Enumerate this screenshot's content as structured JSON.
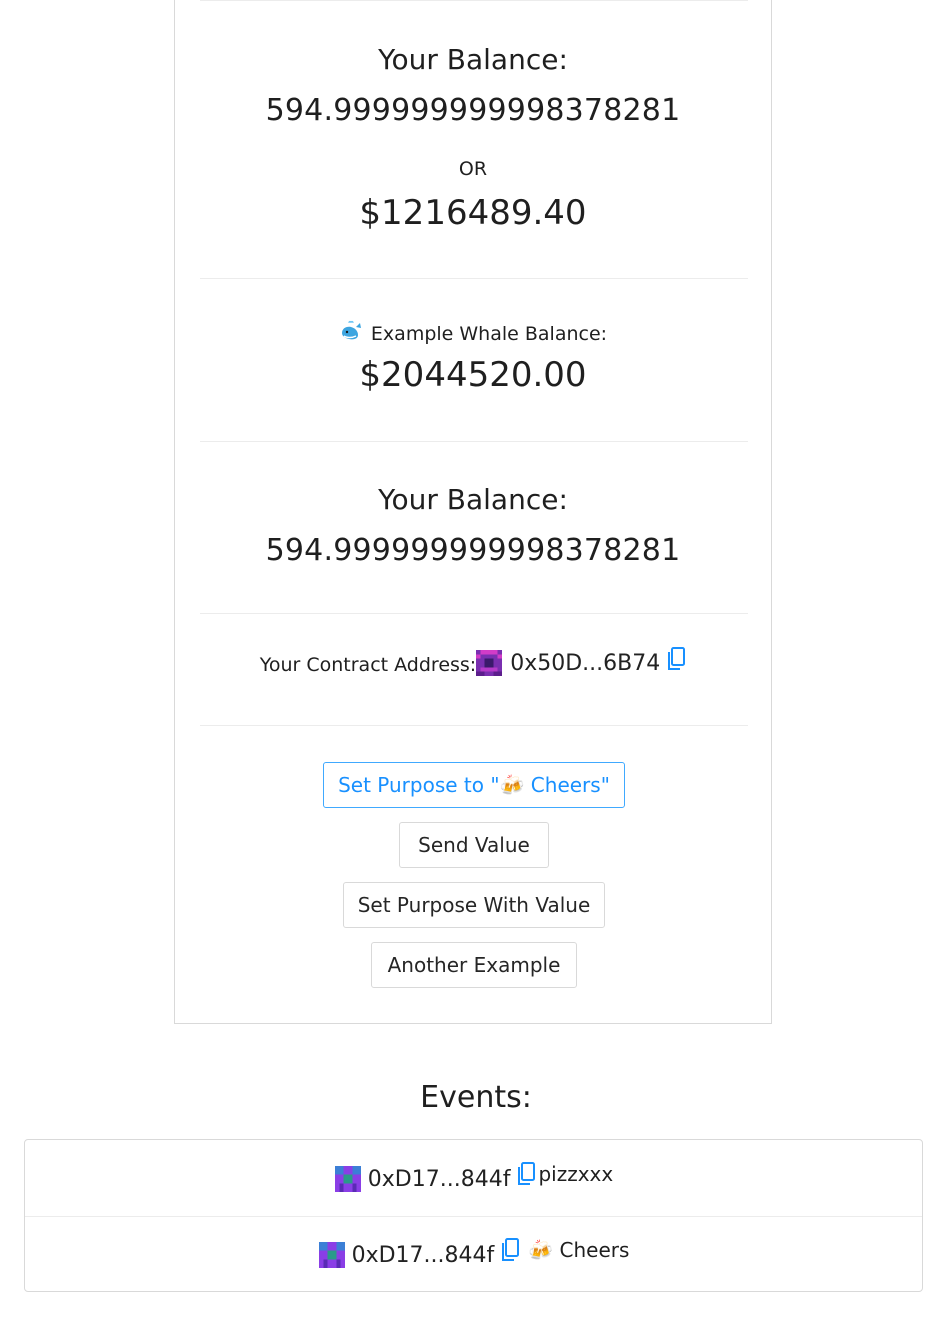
{
  "balance_section": {
    "title": "Your Balance:",
    "value": "594.999999999998378281",
    "or_label": "OR",
    "usd_value": "$1216489.40"
  },
  "whale_section": {
    "icon": "whale-icon",
    "label": "Example Whale Balance:",
    "value": "$2044520.00"
  },
  "balance_section_2": {
    "title": "Your Balance:",
    "value": "594.999999999998378281"
  },
  "contract": {
    "label": "Your Contract Address:",
    "address": "0x50D...6B74",
    "copy_icon": "copy-icon"
  },
  "buttons": {
    "set_purpose": "Set Purpose to \"🍻 Cheers\"",
    "send_value": "Send Value",
    "set_purpose_value": "Set Purpose With Value",
    "another_example": "Another Example"
  },
  "events": {
    "title": "Events:",
    "items": [
      {
        "address": "0xD17...844f",
        "message": "pizzxxx"
      },
      {
        "address": "0xD17...844f",
        "message": "🍻 Cheers"
      }
    ]
  },
  "colors": {
    "accent": "#1890ff",
    "border": "#d9d9d9"
  }
}
